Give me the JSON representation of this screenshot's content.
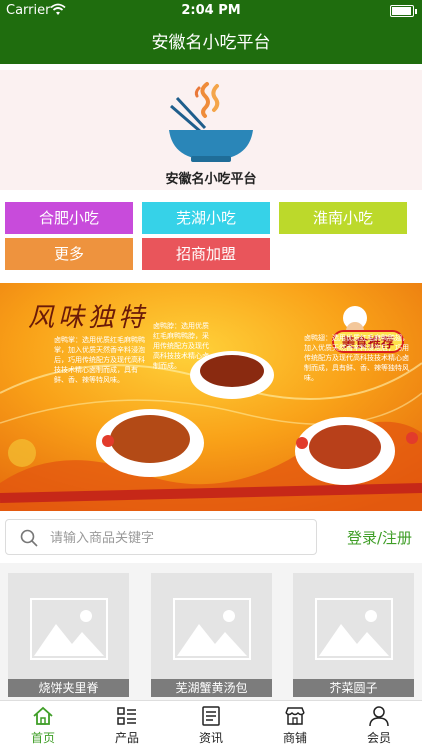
{
  "status_bar": {
    "carrier": "Carrier",
    "time": "2:04 PM"
  },
  "header": {
    "title": "安徽名小吃平台"
  },
  "logo": {
    "text": "安徽名小吃平台",
    "icon": "bowl-chopsticks-icon"
  },
  "categories": [
    {
      "label": "合肥小吃",
      "color": "#c84bdb"
    },
    {
      "label": "芜湖小吃",
      "color": "#36d2e8"
    },
    {
      "label": "淮南小吃",
      "color": "#bcd92b"
    },
    {
      "label": "更多",
      "color": "#ee933e"
    },
    {
      "label": "招商加盟",
      "color": "#e9555b"
    }
  ],
  "banner": {
    "title": "风味独特",
    "tag": "美食推荐",
    "text_1": "卤鸭脖：选用优质红毛麻鸭鸭脖，采用传统配方及现代高科技技术精心卤制而成。",
    "text_2": "卤鸭掌：选用优质红毛麻鸭鸭掌，加入优质天然香辛料浸泡后，巧用传统配方及现代高科技技术精心卤制而成，具有鲜、香、辣等特风味。",
    "text_3": "卤鸭翅：选用优质红毛麻鸭鸭翅，加入优质天然香辛料浸泡后，巧用传统配方及现代高科技技术精心卤制而成，具有鲜、香、辣等独特风味。"
  },
  "search": {
    "placeholder": "请输入商品关键字",
    "value": "",
    "login_label": "登录/注册"
  },
  "products": [
    {
      "name": "烧饼夹里脊"
    },
    {
      "name": "芜湖蟹黄汤包"
    },
    {
      "name": "芥菜圆子"
    }
  ],
  "tabs": [
    {
      "label": "首页",
      "icon": "home-icon",
      "active": true
    },
    {
      "label": "产品",
      "icon": "grid-list-icon"
    },
    {
      "label": "资讯",
      "icon": "news-icon"
    },
    {
      "label": "商铺",
      "icon": "shop-icon"
    },
    {
      "label": "会员",
      "icon": "user-icon"
    }
  ],
  "colors": {
    "primary": "#1f6d0e",
    "accent": "#3f9e27"
  }
}
